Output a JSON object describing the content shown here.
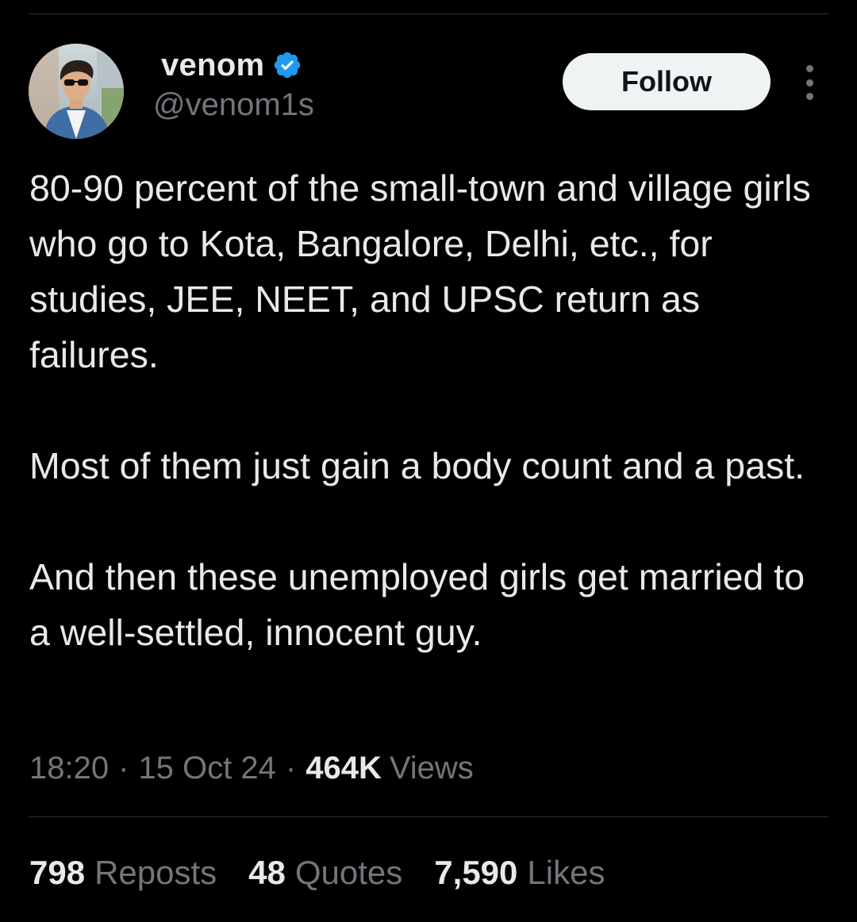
{
  "author": {
    "display_name": "venom",
    "handle": "@venom1s",
    "verified": true,
    "avatar_icon": "profile-photo"
  },
  "actions": {
    "follow_label": "Follow",
    "more_icon": "more-vertical-icon"
  },
  "tweet": {
    "paragraphs": [
      "80-90 percent of the small-town and village girls who go to Kota, Bangalore, Delhi, etc., for studies, JEE, NEET, and UPSC return as failures.",
      "Most of them just gain a body count and a past.",
      "And then these unemployed girls get married to a well-settled, innocent guy."
    ]
  },
  "meta": {
    "time": "18:20",
    "separator": "·",
    "date": "15 Oct 24",
    "views_count": "464K",
    "views_label": "Views"
  },
  "stats": {
    "reposts": {
      "count": "798",
      "label": "Reposts"
    },
    "quotes": {
      "count": "48",
      "label": "Quotes"
    },
    "likes": {
      "count": "7,590",
      "label": "Likes"
    }
  },
  "colors": {
    "background": "#000000",
    "text_primary": "#e7e9ea",
    "text_secondary": "#71767b",
    "verified_blue": "#1d9bf0",
    "follow_bg": "#eff3f4",
    "divider": "#2f3336"
  }
}
